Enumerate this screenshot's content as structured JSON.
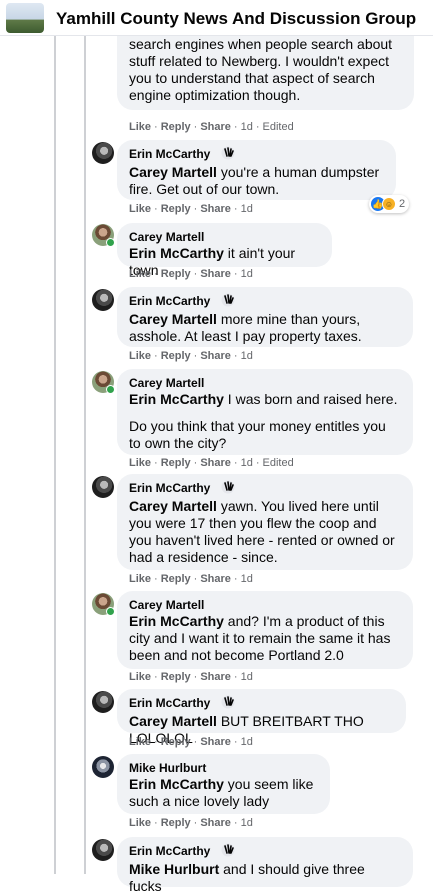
{
  "header": {
    "group_name": "Yamhill County News And Discussion Group"
  },
  "labels": {
    "like": "Like",
    "reply": "Reply",
    "share": "Share",
    "dot": "·",
    "edited": "Edited"
  },
  "comments": [
    {
      "author": "",
      "mention": "",
      "lines": [
        "search engines when people search about",
        "stuff related to Newberg. I wouldn't expect",
        "you to understand that aspect of search",
        "engine optimization though."
      ],
      "time": "1d",
      "edited": true
    },
    {
      "author": "Erin McCarthy",
      "fan": true,
      "mention": "Carey Martell",
      "text": " you're a human dumpster fire. Get out of our town.",
      "time": "1d",
      "edited": false,
      "reactions": {
        "count": "2"
      }
    },
    {
      "author": "Carey Martell",
      "fan": false,
      "mention": "Erin McCarthy",
      "text": " it ain't your town",
      "time": "1d",
      "edited": false
    },
    {
      "author": "Erin McCarthy",
      "fan": true,
      "mention": "Carey Martell",
      "text": " more mine than yours, asshole. At least I pay property taxes.",
      "time": "1d",
      "edited": false
    },
    {
      "author": "Carey Martell",
      "fan": false,
      "mention": "Erin McCarthy",
      "text": " I was born and raised here.",
      "text2": "Do you think that your money entitles you to own the city?",
      "time": "1d",
      "edited": true
    },
    {
      "author": "Erin McCarthy",
      "fan": true,
      "mention": "Carey Martell",
      "text": " yawn. You lived here until you were 17 then you flew the coop and you haven't lived here - rented or owned or had a residence - since.",
      "time": "1d",
      "edited": false
    },
    {
      "author": "Carey Martell",
      "fan": false,
      "mention": "Erin McCarthy",
      "text": " and? I'm a product of this city and I want it to remain the same it has been and not become Portland 2.0",
      "time": "1d",
      "edited": false
    },
    {
      "author": "Erin McCarthy",
      "fan": true,
      "mention": "Carey Martell",
      "text": " BUT BREITBART THO LOLOLOL",
      "time": "1d",
      "edited": false
    },
    {
      "author": "Mike Hurlburt",
      "fan": false,
      "mention": "Erin McCarthy",
      "text": " you seem like such a nice lovely lady",
      "time": "1d",
      "edited": false
    },
    {
      "author": "Erin McCarthy",
      "fan": true,
      "mention": "Mike Hurlburt",
      "text": " and I should give three fucks",
      "time": "",
      "edited": false
    }
  ]
}
